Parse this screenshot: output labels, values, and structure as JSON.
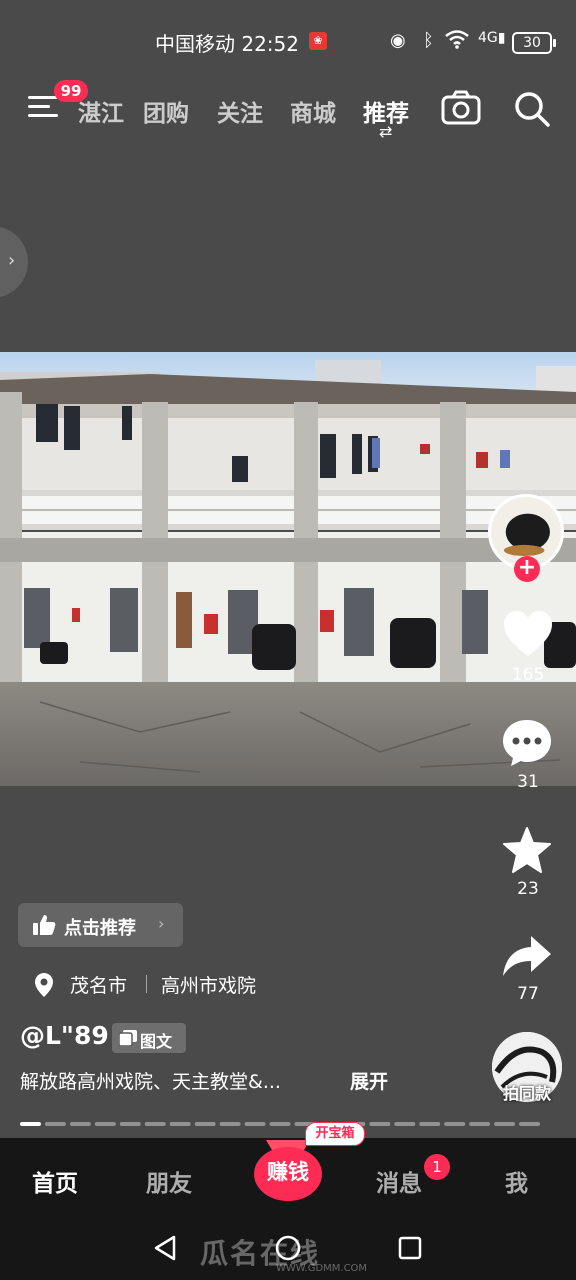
{
  "status_bar": {
    "carrier": "中国移动",
    "time": "22:52",
    "network": "4G",
    "battery": "30"
  },
  "top_nav": {
    "menu_badge": "99",
    "tabs": [
      {
        "label": "湛江"
      },
      {
        "label": "团购"
      },
      {
        "label": "关注"
      },
      {
        "label": "商城"
      },
      {
        "label": "推荐",
        "active": true
      }
    ]
  },
  "right_rail": {
    "likes": "165",
    "comments": "31",
    "favorites": "23",
    "shares": "77",
    "same_style_label": "拍同款"
  },
  "post": {
    "recommend_label": "点击推荐",
    "location_city": "茂名市",
    "location_place": "高州市戏院",
    "author": "@L\"89",
    "type_label": "图文",
    "caption": "解放路高州戏院、天主教堂&...",
    "expand_label": "展开",
    "image_count": 21,
    "current_image": 1
  },
  "bottom_nav": {
    "items": [
      {
        "label": "首页",
        "active": true
      },
      {
        "label": "朋友"
      },
      {
        "label": "赚钱"
      },
      {
        "label": "消息"
      },
      {
        "label": "我"
      }
    ],
    "treasure_tag": "开宝箱",
    "message_badge": "1"
  },
  "watermark": {
    "text": "瓜名在线",
    "url": "WWW.GDMM.COM"
  },
  "colors": {
    "accent": "#fe2c55",
    "background": "#4a4a4a",
    "nav_background": "#161616"
  }
}
